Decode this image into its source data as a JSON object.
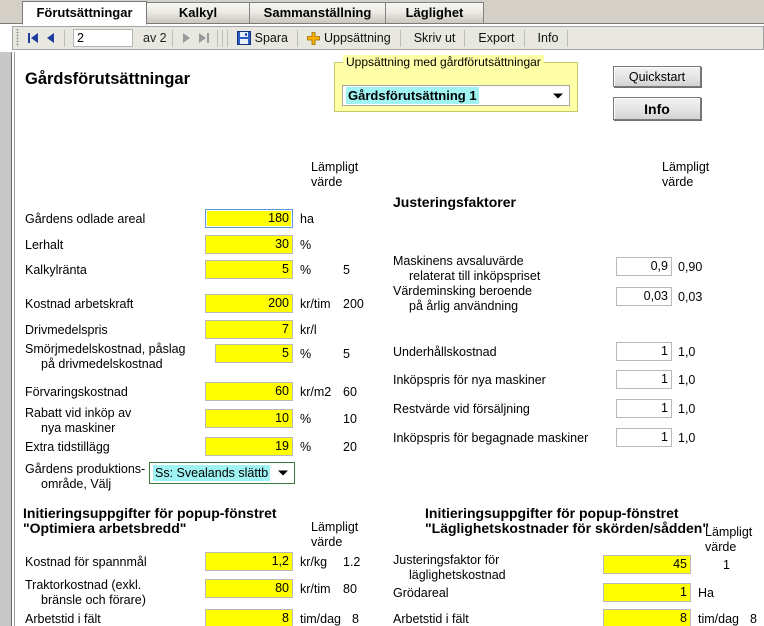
{
  "tabs": [
    {
      "label": "Förutsättningar",
      "active": true
    },
    {
      "label": "Kalkyl",
      "active": false
    },
    {
      "label": "Sammanställning",
      "active": false
    },
    {
      "label": "Läglighet",
      "active": false
    }
  ],
  "toolbar": {
    "first_icon": "first-page-icon",
    "prev_icon": "previous-page-icon",
    "page_value": "2",
    "page_count": "av 2",
    "next_icon": "next-page-icon",
    "last_icon": "last-page-icon",
    "save_label": "Spara",
    "save_icon": "save-disk-icon",
    "new_label": "Uppsättning",
    "new_icon": "plus-icon",
    "print_label": "Skriv ut",
    "export_label": "Export",
    "info_label": "Info"
  },
  "page": {
    "title": "Gårdsförutsättningar",
    "suitable_header_line1": "Lämpligt",
    "suitable_header_line2": "värde"
  },
  "setgroup": {
    "legend": "Uppsättning med gårdförutsättningar",
    "selected": "Gårdsförutsättning 1"
  },
  "buttons": {
    "quickstart": "Quickstart",
    "info": "Info"
  },
  "left_fields": [
    {
      "label1": "Gårdens odlade areal",
      "label2": "",
      "value": "180",
      "unit": "ha",
      "suggested": ""
    },
    {
      "label1": "Lerhalt",
      "label2": "",
      "value": "30",
      "unit": "%",
      "suggested": ""
    },
    {
      "label1": "Kalkylränta",
      "label2": "",
      "value": "5",
      "unit": "%",
      "suggested": "5"
    },
    {
      "label1": "Kostnad arbetskraft",
      "label2": "",
      "value": "200",
      "unit": "kr/tim",
      "suggested": "200"
    },
    {
      "label1": "Drivmedelspris",
      "label2": "",
      "value": "7",
      "unit": "kr/l",
      "suggested": ""
    },
    {
      "label1": "Smörjmedelskostnad, påslag",
      "label2": "på drivmedelskostnad",
      "value": "5",
      "unit": "%",
      "suggested": "5"
    },
    {
      "label1": "Förvaringskostnad",
      "label2": "",
      "value": "60",
      "unit": "kr/m2",
      "suggested": "60"
    },
    {
      "label1": "Rabatt vid inköp av",
      "label2": "nya maskiner",
      "value": "10",
      "unit": "%",
      "suggested": "10"
    },
    {
      "label1": "Extra tidstillägg",
      "label2": "",
      "value": "19",
      "unit": "%",
      "suggested": "20"
    }
  ],
  "prodarea": {
    "label1": "Gårdens produktions-",
    "label2": "område, Välj",
    "selected": "Ss: Svealands slättb"
  },
  "adjust": {
    "title": "Justeringsfaktorer",
    "suitable_header_line1": "Lämpligt",
    "suitable_header_line2": "värde",
    "fields": [
      {
        "label1": "Maskinens avsaluvärde",
        "label2": "relaterat till inköpspriset",
        "value": "0,9",
        "suggested": "0,90"
      },
      {
        "label1": "Värdeminsking  beroende",
        "label2": "på årlig användning",
        "value": "0,03",
        "suggested": "0,03"
      },
      {
        "label1": "Underhållskostnad",
        "label2": "",
        "value": "1",
        "suggested": "1,0"
      },
      {
        "label1": "Inköpspris för nya maskiner",
        "label2": "",
        "value": "1",
        "suggested": "1,0"
      },
      {
        "label1": "Restvärde vid försäljning",
        "label2": "",
        "value": "1",
        "suggested": "1,0"
      },
      {
        "label1": "Inköpspris för begagnade maskiner",
        "label2": "",
        "value": "1",
        "suggested": "1,0"
      }
    ]
  },
  "popup_left": {
    "title_line1": "Initieringsuppgifter för popup-fönstret",
    "title_line2": "\"Optimiera arbetsbredd\"",
    "suitable_header_line1": "Lämpligt",
    "suitable_header_line2": "värde",
    "fields": [
      {
        "label1": "Kostnad för spannmål",
        "label2": "",
        "value": "1,2",
        "unit": "kr/kg",
        "suggested": "1.2"
      },
      {
        "label1": "Traktorkostnad (exkl.",
        "label2": "bränsle  och förare)",
        "value": "80",
        "unit": "kr/tim",
        "suggested": "80"
      },
      {
        "label1": "Arbetstid i fält",
        "label2": "",
        "value": "8",
        "unit": "tim/dag",
        "suggested": "8"
      }
    ]
  },
  "popup_right": {
    "title_line1": "Initieringsuppgifter för popup-fönstret",
    "title_line2": "\"Läglighetskostnader för skörden/sådden\"",
    "suitable_header_line1": "Lämpligt",
    "suitable_header_line2": "värde",
    "fields": [
      {
        "label1": "Justeringsfaktor för",
        "label2": "läglighetskostnad",
        "value": "45",
        "unit": "",
        "suggested": "1"
      },
      {
        "label1": "Grödareal",
        "label2": "",
        "value": "1",
        "unit": "Ha",
        "suggested": ""
      },
      {
        "label1": "Arbetstid i fält",
        "label2": "",
        "value": "8",
        "unit": "tim/dag",
        "suggested": "8"
      }
    ]
  },
  "colors": {
    "field_yellow": "#ffff00",
    "highlight_cyan": "#9ff3f3",
    "group_yellow": "#ffffa8",
    "nav_blue": "#1f3f9e",
    "nav_disabled": "#9a9a9a"
  }
}
